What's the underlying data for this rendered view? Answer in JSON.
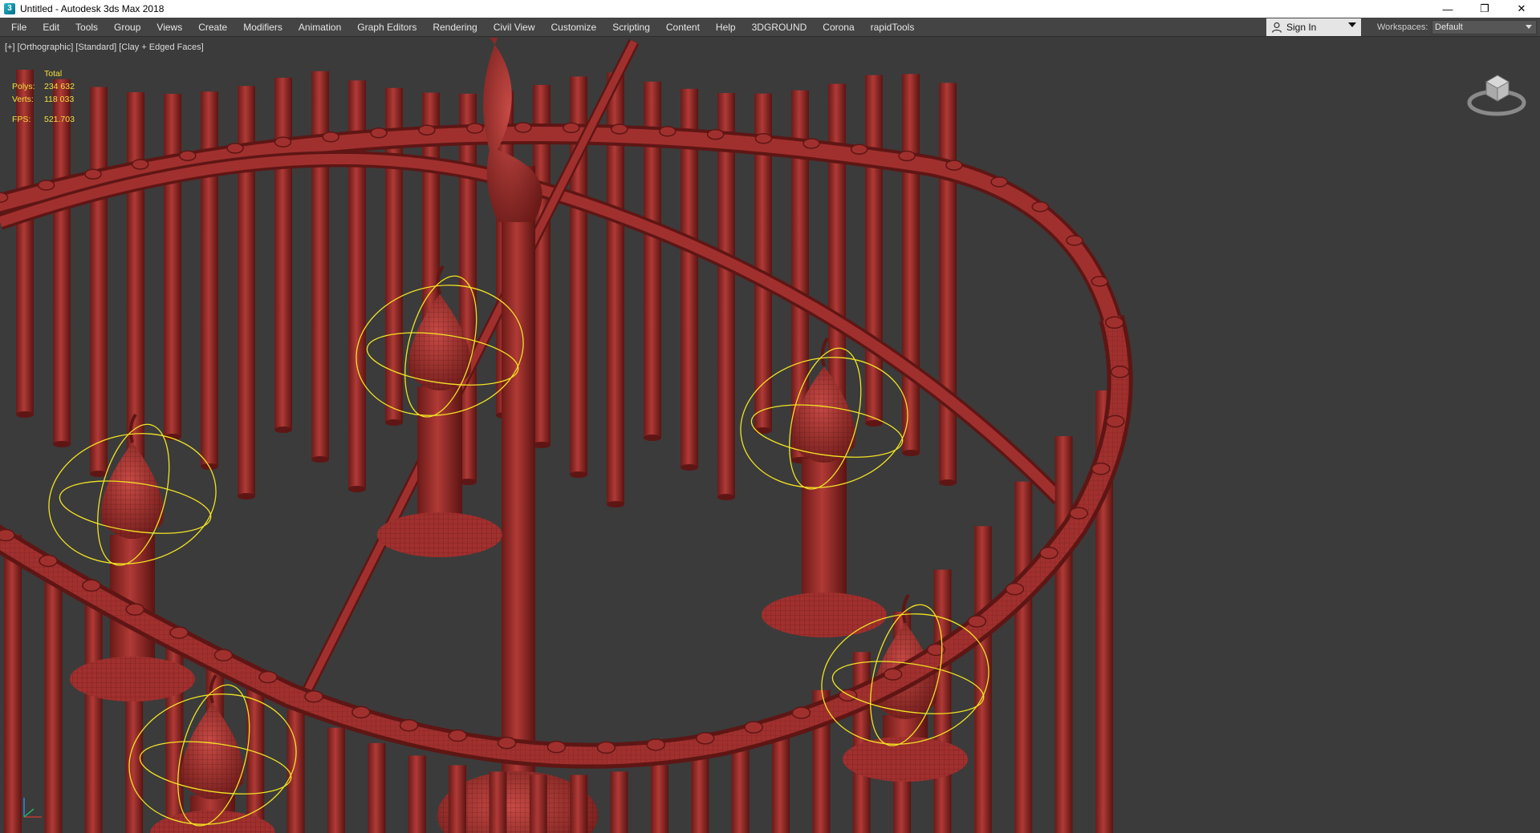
{
  "window": {
    "title": "Untitled - Autodesk 3ds Max 2018",
    "icon": "3ds-max-app-icon",
    "minimize": "—",
    "restore": "❐",
    "close": "✕"
  },
  "menu": {
    "items": [
      "File",
      "Edit",
      "Tools",
      "Group",
      "Views",
      "Create",
      "Modifiers",
      "Animation",
      "Graph Editors",
      "Rendering",
      "Civil View",
      "Customize",
      "Scripting",
      "Content",
      "Help",
      "3DGROUND",
      "Corona",
      "rapidTools"
    ],
    "sign_in": "Sign In",
    "workspaces_label": "Workspaces:",
    "workspace_value": "Default"
  },
  "viewport": {
    "label_plus": "[+]",
    "label_view": "[Orthographic]",
    "label_shading_std": "[Standard]",
    "label_shading": "[Clay + Edged Faces]",
    "stats": {
      "header": "Total",
      "polys_label": "Polys:",
      "polys_value": "234 632",
      "verts_label": "Verts:",
      "verts_value": "118 033",
      "fps_label": "FPS:",
      "fps_value": "521.703"
    },
    "colors": {
      "background": "#3b3b3b",
      "mesh": "#a0302e",
      "mesh_dark": "#5e1614",
      "selection": "#f2e324"
    }
  }
}
